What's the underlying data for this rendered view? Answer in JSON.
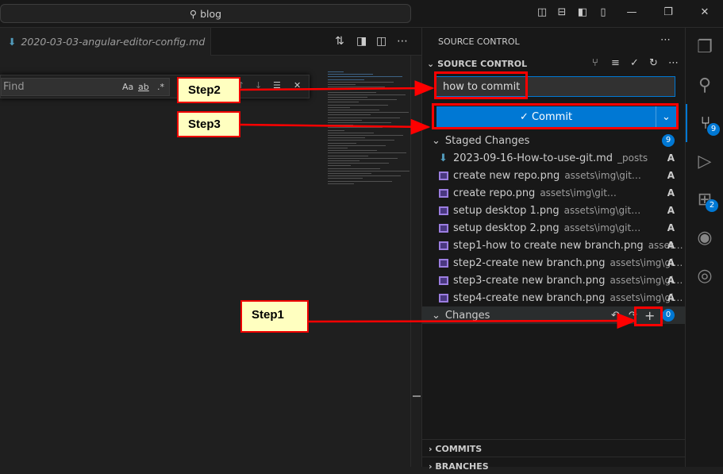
{
  "titlebar": {
    "search_text": "blog",
    "icons": [
      "toggle-primary-sidebar-icon",
      "toggle-panel-icon",
      "toggle-secondary-sidebar-icon",
      "customize-layout-icon",
      "minimize-icon",
      "restore-icon",
      "close-icon"
    ]
  },
  "editor": {
    "tab_label": "2020-03-03-angular-editor-config.md",
    "find": {
      "placeholder": "Find",
      "match_case": "Aa",
      "whole_word": "ab",
      "regex": ".*"
    }
  },
  "sidebar": {
    "title": "SOURCE CONTROL",
    "section": "SOURCE CONTROL",
    "commit_message": "how to commit",
    "commit_label": "Commit",
    "staged": {
      "label": "Staged Changes",
      "count": "9",
      "items": [
        {
          "name": "2023-09-16-How-to-use-git.md",
          "path": "_posts",
          "status": "A",
          "icon": "markdown-icon"
        },
        {
          "name": "create new repo.png",
          "path": "assets\\img\\git-pics",
          "status": "A",
          "icon": "image-icon"
        },
        {
          "name": "create repo.png",
          "path": "assets\\img\\git-pics",
          "status": "A",
          "icon": "image-icon"
        },
        {
          "name": "setup desktop 1.png",
          "path": "assets\\img\\git-pics",
          "status": "A",
          "icon": "image-icon"
        },
        {
          "name": "setup desktop 2.png",
          "path": "assets\\img\\git-pics",
          "status": "A",
          "icon": "image-icon"
        },
        {
          "name": "step1-how to create new branch.png",
          "path": "assets\\i...",
          "status": "A",
          "icon": "image-icon"
        },
        {
          "name": "step2-create new branch.png",
          "path": "assets\\img\\git-...",
          "status": "A",
          "icon": "image-icon"
        },
        {
          "name": "step3-create new branch.png",
          "path": "assets\\img\\git-...",
          "status": "A",
          "icon": "image-icon"
        },
        {
          "name": "step4-create new branch.png",
          "path": "assets\\img\\git-...",
          "status": "A",
          "icon": "image-icon"
        }
      ]
    },
    "changes": {
      "label": "Changes",
      "count": "0"
    },
    "commits": "COMMITS",
    "branches": "BRANCHES"
  },
  "activity": {
    "scm_badge": "9",
    "extensions_badge": "2"
  },
  "annotations": {
    "step1": "Step1",
    "step2": "Step2",
    "step3": "Step3",
    "color": "#ff0000"
  }
}
